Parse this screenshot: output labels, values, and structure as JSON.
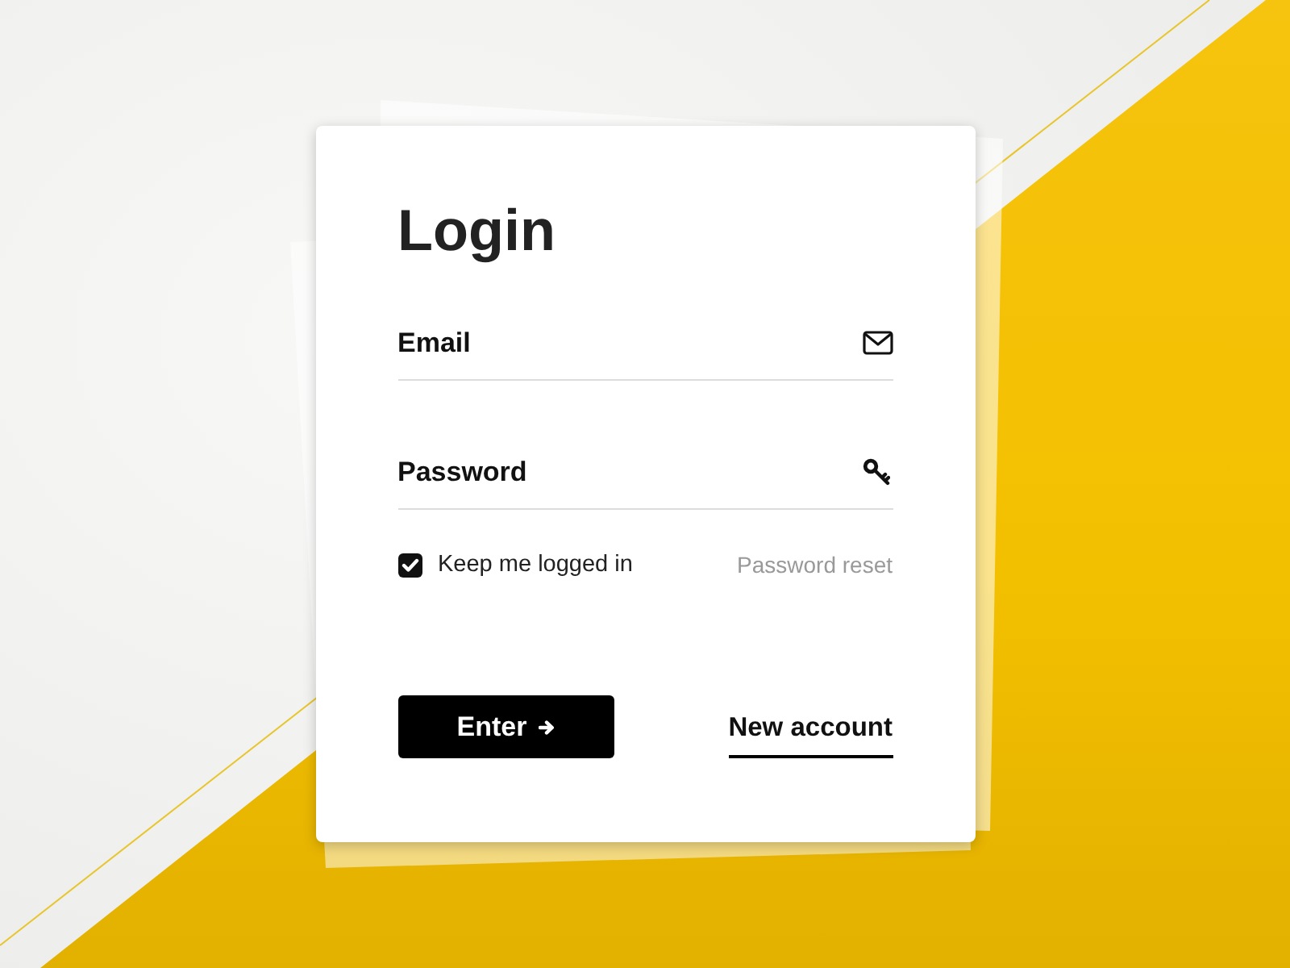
{
  "login": {
    "title": "Login",
    "fields": [
      {
        "kind": "email",
        "placeholder": "Email"
      },
      {
        "kind": "password",
        "placeholder": "Password"
      }
    ],
    "remember": {
      "label": "Keep me logged in",
      "checked": true
    },
    "reset_link": "Password reset",
    "submit_button": "Enter",
    "new_account_link": "New account"
  }
}
